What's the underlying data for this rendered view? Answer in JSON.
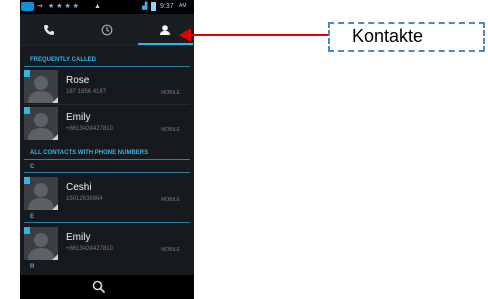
{
  "statusbar": {
    "time": "9:37",
    "ampm": "AM"
  },
  "tabs": [
    {
      "icon": "phone-icon",
      "selected": false
    },
    {
      "icon": "clock-icon",
      "selected": false
    },
    {
      "icon": "contact-icon",
      "selected": true
    }
  ],
  "sections": {
    "frequently_called": "FREQUENTLY CALLED",
    "all_contacts": "ALL CONTACTS WITH PHONE NUMBERS"
  },
  "frequent": [
    {
      "name": "Rose",
      "number": "187 1856 4187",
      "type": "MOBILE"
    },
    {
      "name": "Emily",
      "number": "+8613424427810",
      "type": "MOBILE"
    }
  ],
  "letters": {
    "c": "C",
    "e": "E",
    "r": "R"
  },
  "contacts": [
    {
      "name": "Ceshi",
      "number": "15012638964",
      "type": "MOBILE"
    },
    {
      "name": "Emily",
      "number": "+8613424427810",
      "type": "MOBILE"
    }
  ],
  "callout": {
    "label": "Kontakte"
  },
  "colors": {
    "accent": "#33b5e5",
    "pointer": "#e30000",
    "callout_border": "#4a88c7"
  }
}
